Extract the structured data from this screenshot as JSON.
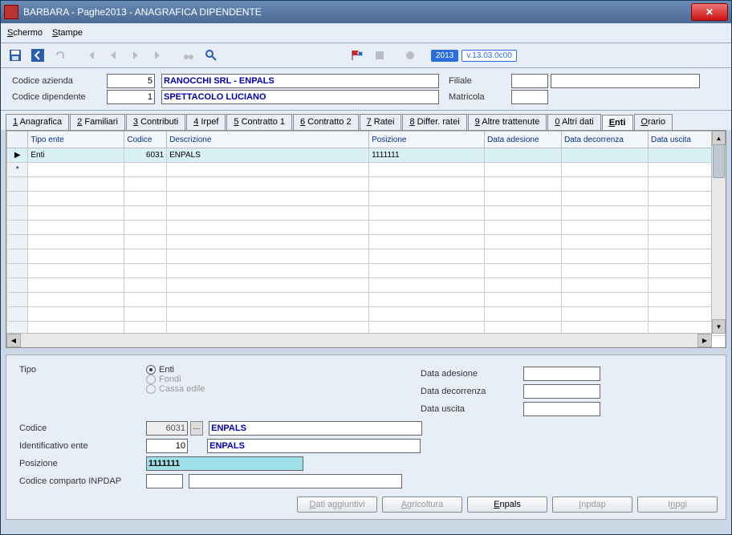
{
  "window": {
    "title": "BARBARA - Paghe2013 - ANAGRAFICA DIPENDENTE"
  },
  "menu": {
    "schermo": "Schermo",
    "stampe": "Stampe"
  },
  "toolbar": {
    "year": "2013",
    "version": "v.13.03.0c00"
  },
  "header": {
    "codAziendaLabel": "Codice azienda",
    "codAzienda": "5",
    "azienda": "RANOCCHI SRL - ENPALS",
    "codDipLabel": "Codice dipendente",
    "codDip": "1",
    "dipendente": "SPETTACOLO LUCIANO",
    "filialeLabel": "Filiale",
    "filiale1": "",
    "filiale2": "",
    "matricolaLabel": "Matricola",
    "matricola": ""
  },
  "tabs": {
    "t1": "1 Anagrafica",
    "t2": "2 Familiari",
    "t3": "3 Contributi",
    "t4": "4 Irpef",
    "t5": "5 Contratto 1",
    "t6": "6 Contratto 2",
    "t7": "7 Ratei",
    "t8": "8 Differ. ratei",
    "t9": "9 Altre trattenute",
    "t0": "0 Altri dati",
    "tE": "Enti",
    "tO": "Orario"
  },
  "grid": {
    "cols": {
      "tipo": "Tipo ente",
      "codice": "Codice",
      "descr": "Descrizione",
      "pos": "Posizione",
      "ade": "Data adesione",
      "dec": "Data decorrenza",
      "usc": "Data uscita"
    },
    "rows": [
      {
        "mark": "▶",
        "tipo": "Enti",
        "codice": "6031",
        "descr": "ENPALS",
        "pos": "1111111",
        "ade": "",
        "dec": "",
        "usc": ""
      }
    ],
    "newmark": "*"
  },
  "detail": {
    "tipoLabel": "Tipo",
    "r1": "Enti",
    "r2": "Fondi",
    "r3": "Cassa edile",
    "codiceLabel": "Codice",
    "codice": "6031",
    "codDesc": "ENPALS",
    "identLabel": "Identificativo ente",
    "ident": "10",
    "identDesc": "ENPALS",
    "posLabel": "Posizione",
    "pos": "1111111",
    "inpdapLabel": "Codice comparto INPDAP",
    "inpdap": "",
    "adeLabel": "Data adesione",
    "ade": "",
    "decLabel": "Data decorrenza",
    "dec": "",
    "uscLabel": "Data uscita",
    "usc": ""
  },
  "buttons": {
    "b1": "Dati aggiuntivi",
    "b2": "Agricoltura",
    "b3": "Enpals",
    "b4": "Inpdap",
    "b5": "Inpgi"
  }
}
